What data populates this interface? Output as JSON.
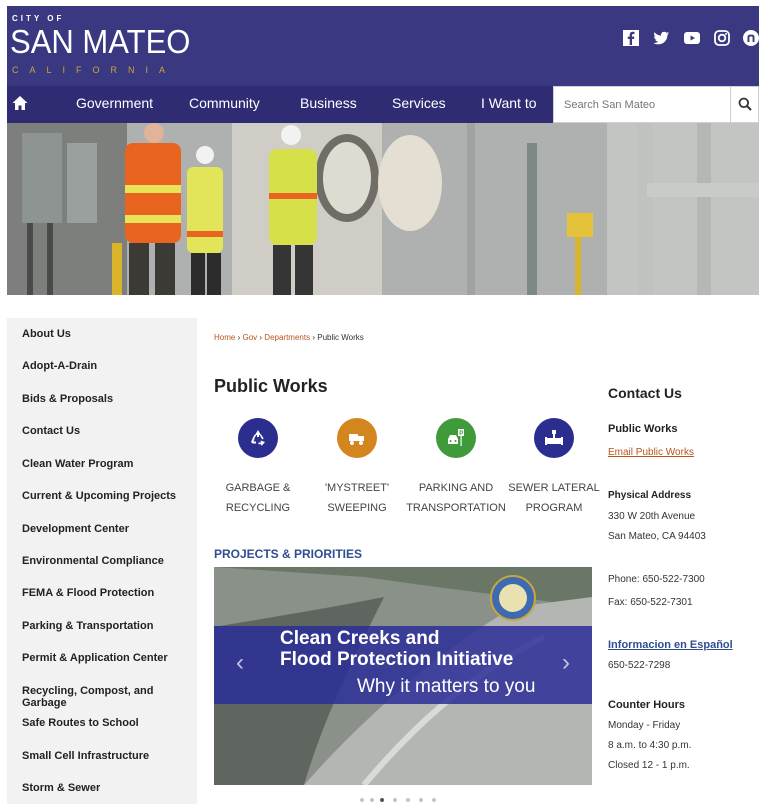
{
  "header": {
    "logo_city": "CITY OF",
    "logo_name": "SAN MATEO",
    "logo_state": "CALIFORNIA",
    "social": [
      "facebook-icon",
      "twitter-icon",
      "youtube-icon",
      "instagram-icon",
      "nextdoor-icon"
    ]
  },
  "nav": {
    "items": [
      "Government",
      "Community",
      "Business",
      "Services",
      "I Want to"
    ],
    "search_placeholder": "Search San Mateo"
  },
  "sidebar": {
    "items": [
      "About Us",
      "Adopt-A-Drain",
      "Bids & Proposals",
      "Contact Us",
      "Clean Water Program",
      "Current & Upcoming Projects",
      "Development Center",
      "Environmental Compliance",
      "FEMA & Flood Protection",
      "Parking & Transportation",
      "Permit & Application Center",
      "Recycling, Compost, and Garbage",
      "Safe Routes to School",
      "Small Cell Infrastructure",
      "Storm & Sewer"
    ]
  },
  "breadcrumb": {
    "home": "Home",
    "gov": "Gov",
    "departments": "Departments",
    "current": "Public Works",
    "sep": "›"
  },
  "main": {
    "title": "Public Works",
    "quick_links": [
      {
        "line1": "Garbage &",
        "line2": "Recycling",
        "color": "#2b2e8f",
        "icon": "recycle-icon"
      },
      {
        "line1": "'MyStreet'",
        "line2": "Sweeping",
        "color": "#d4861e",
        "icon": "street-sweeper-icon"
      },
      {
        "line1": "Parking and",
        "line2": "Transportation",
        "color": "#3f9a3a",
        "icon": "parking-car-icon"
      },
      {
        "line1": "Sewer Lateral",
        "line2": "Program",
        "color": "#2b2e8f",
        "icon": "pipe-icon"
      }
    ],
    "section_heading": "PROJECTS & PRIORITIES",
    "slider": {
      "title_line1": "Clean Creeks and",
      "title_line2": "Flood Protection Initiative",
      "subtitle": "Why it matters to you",
      "dots": 7,
      "active_dot": 2
    }
  },
  "contact": {
    "heading": "Contact Us",
    "dept": "Public Works",
    "email_link": "Email Public Works",
    "address_label": "Physical Address",
    "address_line1": "330 W 20th Avenue",
    "address_line2": "San Mateo, CA 94403",
    "phone": "Phone: 650-522-7300",
    "fax": "Fax: 650-522-7301",
    "spanish_link": "Informacion en Español",
    "spanish_phone": "650-522-7298",
    "hours_label": "Counter Hours",
    "hours_days": "Monday - Friday",
    "hours_time": "8 a.m. to 4:30 p.m.",
    "hours_closed": "Closed 12 - 1 p.m."
  },
  "colors": {
    "header": "#3b3882",
    "nav": "#2f2c74",
    "accent_link": "#b7541a",
    "heading_blue": "#2f4d8f"
  }
}
